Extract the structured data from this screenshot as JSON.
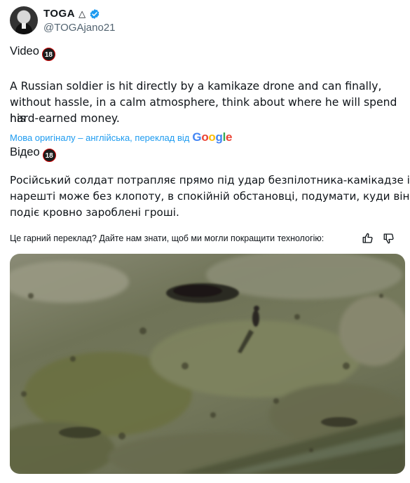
{
  "author": {
    "name": "TOGA",
    "handle": "@TOGAjano21",
    "name_symbol": "△"
  },
  "original": {
    "line1": "Video",
    "body_lines": [
      "A Russian soldier is hit directly by a kamikaze drone and can finally,",
      "without hassle, in a calm atmosphere, think about where he will spend his",
      "hard-earned money."
    ]
  },
  "age_badge": "18",
  "translation_note": {
    "text": "Мова оригіналу – англійська, переклад від",
    "provider": "Google"
  },
  "translated": {
    "line1": "Відео",
    "body_lines": [
      "Російський солдат потрапляє прямо під удар безпілотника-камікадзе і",
      "нарешті може без клопоту, в спокійній обстановці, подумати, куди він",
      "подіє кровно зароблені гроші."
    ]
  },
  "feedback": {
    "prompt": "Це гарний переклад? Дайте нам знати, щоб ми могли покращити технологію:"
  },
  "colors": {
    "link_blue": "#1d9bf0",
    "verified_blue": "#1d9bf0",
    "text": "#0f1419",
    "muted": "#536471"
  },
  "icons": [
    "verified-badge-icon",
    "thumbs-up-icon",
    "thumbs-down-icon",
    "age-restriction-18-icon"
  ]
}
